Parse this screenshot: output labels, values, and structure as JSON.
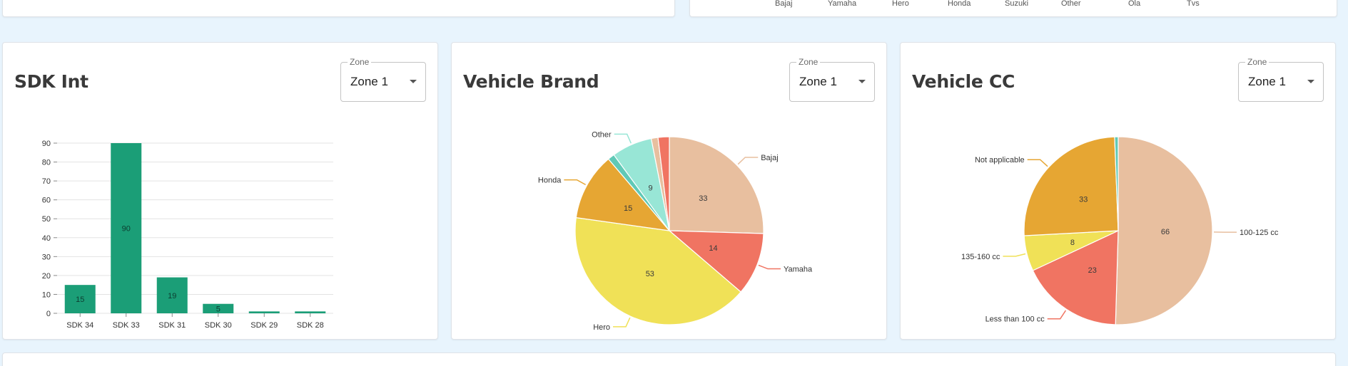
{
  "top_axis_labels": [
    "Bajaj",
    "Yamaha",
    "Hero",
    "Honda",
    "Suzuki",
    "Other",
    "Ola",
    "Tvs"
  ],
  "cards": [
    {
      "title": "SDK Int",
      "zone": {
        "label": "Zone",
        "value": "Zone 1"
      }
    },
    {
      "title": "Vehicle Brand",
      "zone": {
        "label": "Zone",
        "value": "Zone 1"
      }
    },
    {
      "title": "Vehicle CC",
      "zone": {
        "label": "Zone",
        "value": "Zone 1"
      }
    }
  ],
  "chart_data": [
    {
      "type": "bar",
      "title": "SDK Int",
      "categories": [
        "SDK 34",
        "SDK 33",
        "SDK 31",
        "SDK 30",
        "SDK 29",
        "SDK 28"
      ],
      "values": [
        15,
        90,
        19,
        5,
        1,
        1
      ],
      "data_labels": [
        "15",
        "90",
        "19",
        "5",
        "",
        ""
      ],
      "ylim": [
        0,
        90
      ],
      "yticks": [
        0,
        10,
        20,
        30,
        40,
        50,
        60,
        70,
        80,
        90
      ],
      "grid": true,
      "color": "#1b9e77"
    },
    {
      "type": "pie",
      "title": "Vehicle Brand",
      "slices": [
        {
          "label": "Bajaj",
          "value": 33,
          "color": "#e8bf9f",
          "show_value": true,
          "show_label": true
        },
        {
          "label": "Yamaha",
          "value": 14,
          "color": "#f07462",
          "show_value": true,
          "show_label": true
        },
        {
          "label": "Hero",
          "value": 53,
          "color": "#f0e157",
          "show_value": true,
          "show_label": true
        },
        {
          "label": "Honda",
          "value": 15,
          "color": "#e6a633",
          "show_value": true,
          "show_label": true
        },
        {
          "label": "",
          "value": 1.5,
          "color": "#60c9b6",
          "show_value": false,
          "show_label": false
        },
        {
          "label": "Other",
          "value": 9,
          "color": "#98e6d6",
          "show_value": true,
          "show_label": true
        },
        {
          "label": "",
          "value": 1.5,
          "color": "#e8bf9f",
          "show_value": false,
          "show_label": false
        },
        {
          "label": "",
          "value": 2.5,
          "color": "#f07462",
          "show_value": false,
          "show_label": false
        }
      ]
    },
    {
      "type": "pie",
      "title": "Vehicle CC",
      "slices": [
        {
          "label": "100-125 cc",
          "value": 66,
          "color": "#e8bf9f",
          "show_value": true,
          "show_label": true
        },
        {
          "label": "Less than 100 cc",
          "value": 23,
          "color": "#f07462",
          "show_value": true,
          "show_label": true
        },
        {
          "label": "135-160 cc",
          "value": 8,
          "color": "#f0e157",
          "show_value": true,
          "show_label": true
        },
        {
          "label": "Not applicable",
          "value": 33,
          "color": "#e6a633",
          "show_value": true,
          "show_label": true
        },
        {
          "label": "",
          "value": 0.8,
          "color": "#60c9b6",
          "show_value": false,
          "show_label": false
        }
      ]
    }
  ]
}
